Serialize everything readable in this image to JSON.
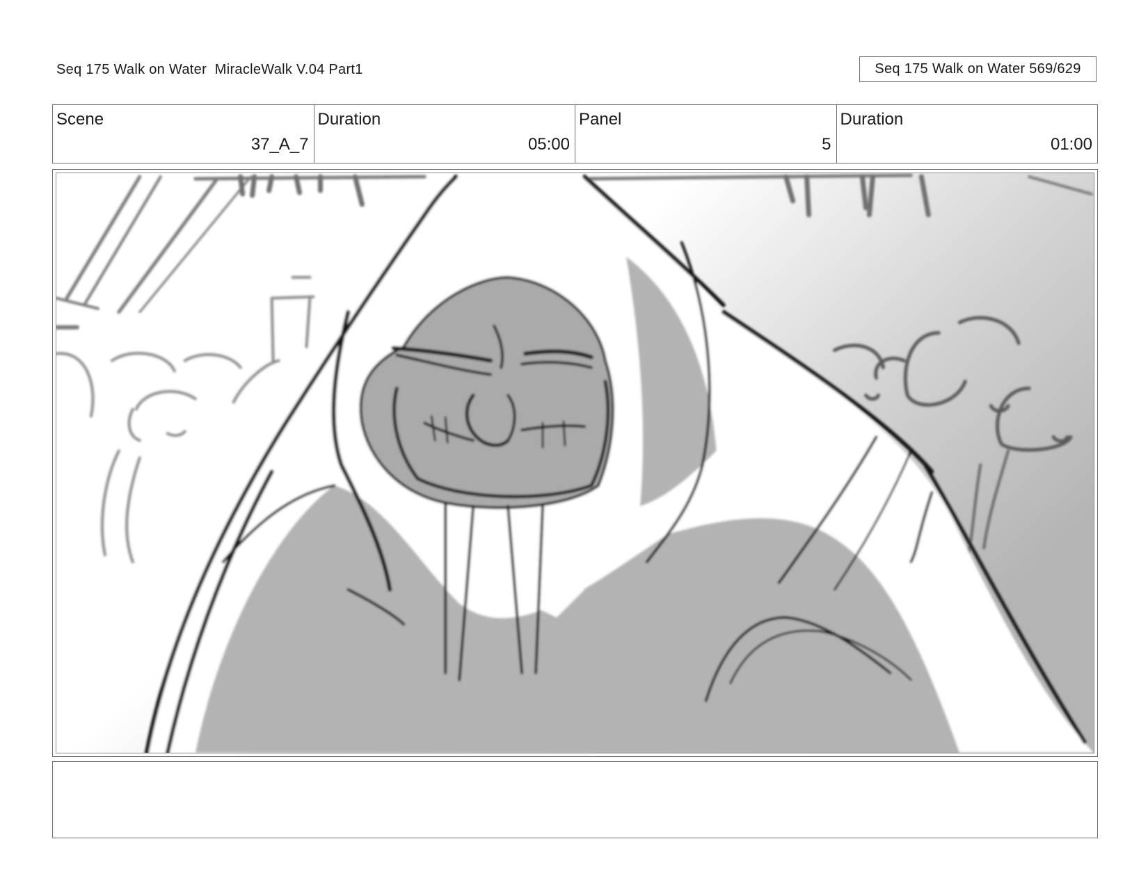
{
  "header": {
    "title": "Seq 175 Walk on Water  MiracleWalk V.04 Part1",
    "page_counter": "Seq 175 Walk on Water 569/629"
  },
  "info": {
    "scene_label": "Scene",
    "scene_value": "37_A_7",
    "scene_duration_label": "Duration",
    "scene_duration_value": "05:00",
    "panel_label": "Panel",
    "panel_value": "5",
    "panel_duration_label": "Duration",
    "panel_duration_value": "01:00"
  },
  "panel": {
    "image_description_icon": "storyboard-sketch-hooded-figure"
  },
  "notes": {
    "text": ""
  }
}
